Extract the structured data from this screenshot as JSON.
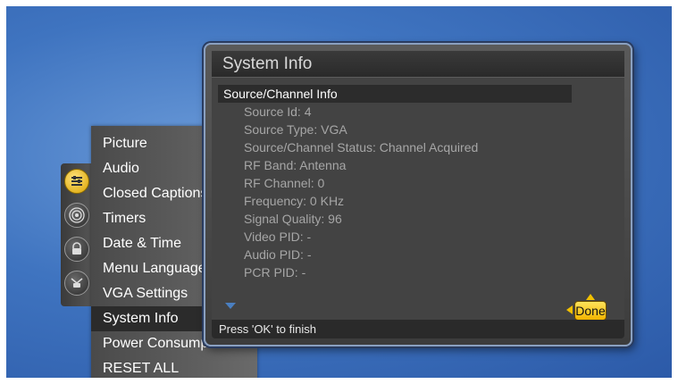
{
  "dialog": {
    "title": "System Info",
    "section_header": "Source/Channel Info",
    "lines": [
      "Source Id: 4",
      "Source Type: VGA",
      "Source/Channel Status: Channel Acquired",
      "RF Band: Antenna",
      "RF Channel: 0",
      "Frequency: 0  KHz",
      "Signal Quality: 96",
      "Video PID: -",
      "Audio PID: -",
      "PCR PID: -"
    ],
    "status_text": "Press 'OK' to finish",
    "done_label": "Done"
  },
  "menu": {
    "items": [
      "Picture",
      "Audio",
      "Closed Captions",
      "Timers",
      "Date & Time",
      "Menu Language",
      "VGA Settings",
      "System Info",
      "Power Consumption",
      "RESET ALL"
    ],
    "selected_index": 7
  },
  "icons": [
    "settings-icon",
    "antenna-icon",
    "lock-icon",
    "input-icon"
  ],
  "colors": {
    "background": "#3f74c0",
    "accent": "#f2b400",
    "selection": "#2b2b2b"
  }
}
